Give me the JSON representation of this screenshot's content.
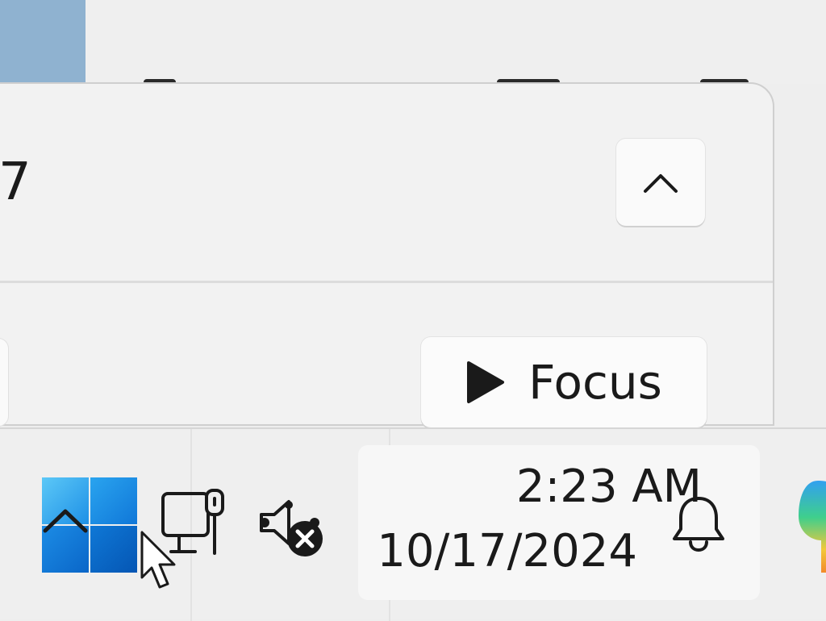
{
  "background": {
    "window_color": "#8fb2d0"
  },
  "flyout": {
    "date_fragment": "7",
    "collapse_button_icon": "chevron-up-icon",
    "focus_button": {
      "icon": "play-icon",
      "label": "Focus"
    }
  },
  "taskbar": {
    "start_button_icon": "windows-logo-icon",
    "tray_overflow_icon": "chevron-up-icon",
    "network_icon": "ethernet-network-icon",
    "volume_icon": "volume-muted-icon",
    "clock": {
      "time": "2:23 AM",
      "date": "10/17/2024"
    },
    "notifications_icon": "bell-icon",
    "copilot_icon": "copilot-icon"
  },
  "colors": {
    "accent_start": "#0067c0",
    "taskbar_bg": "#efefef"
  }
}
